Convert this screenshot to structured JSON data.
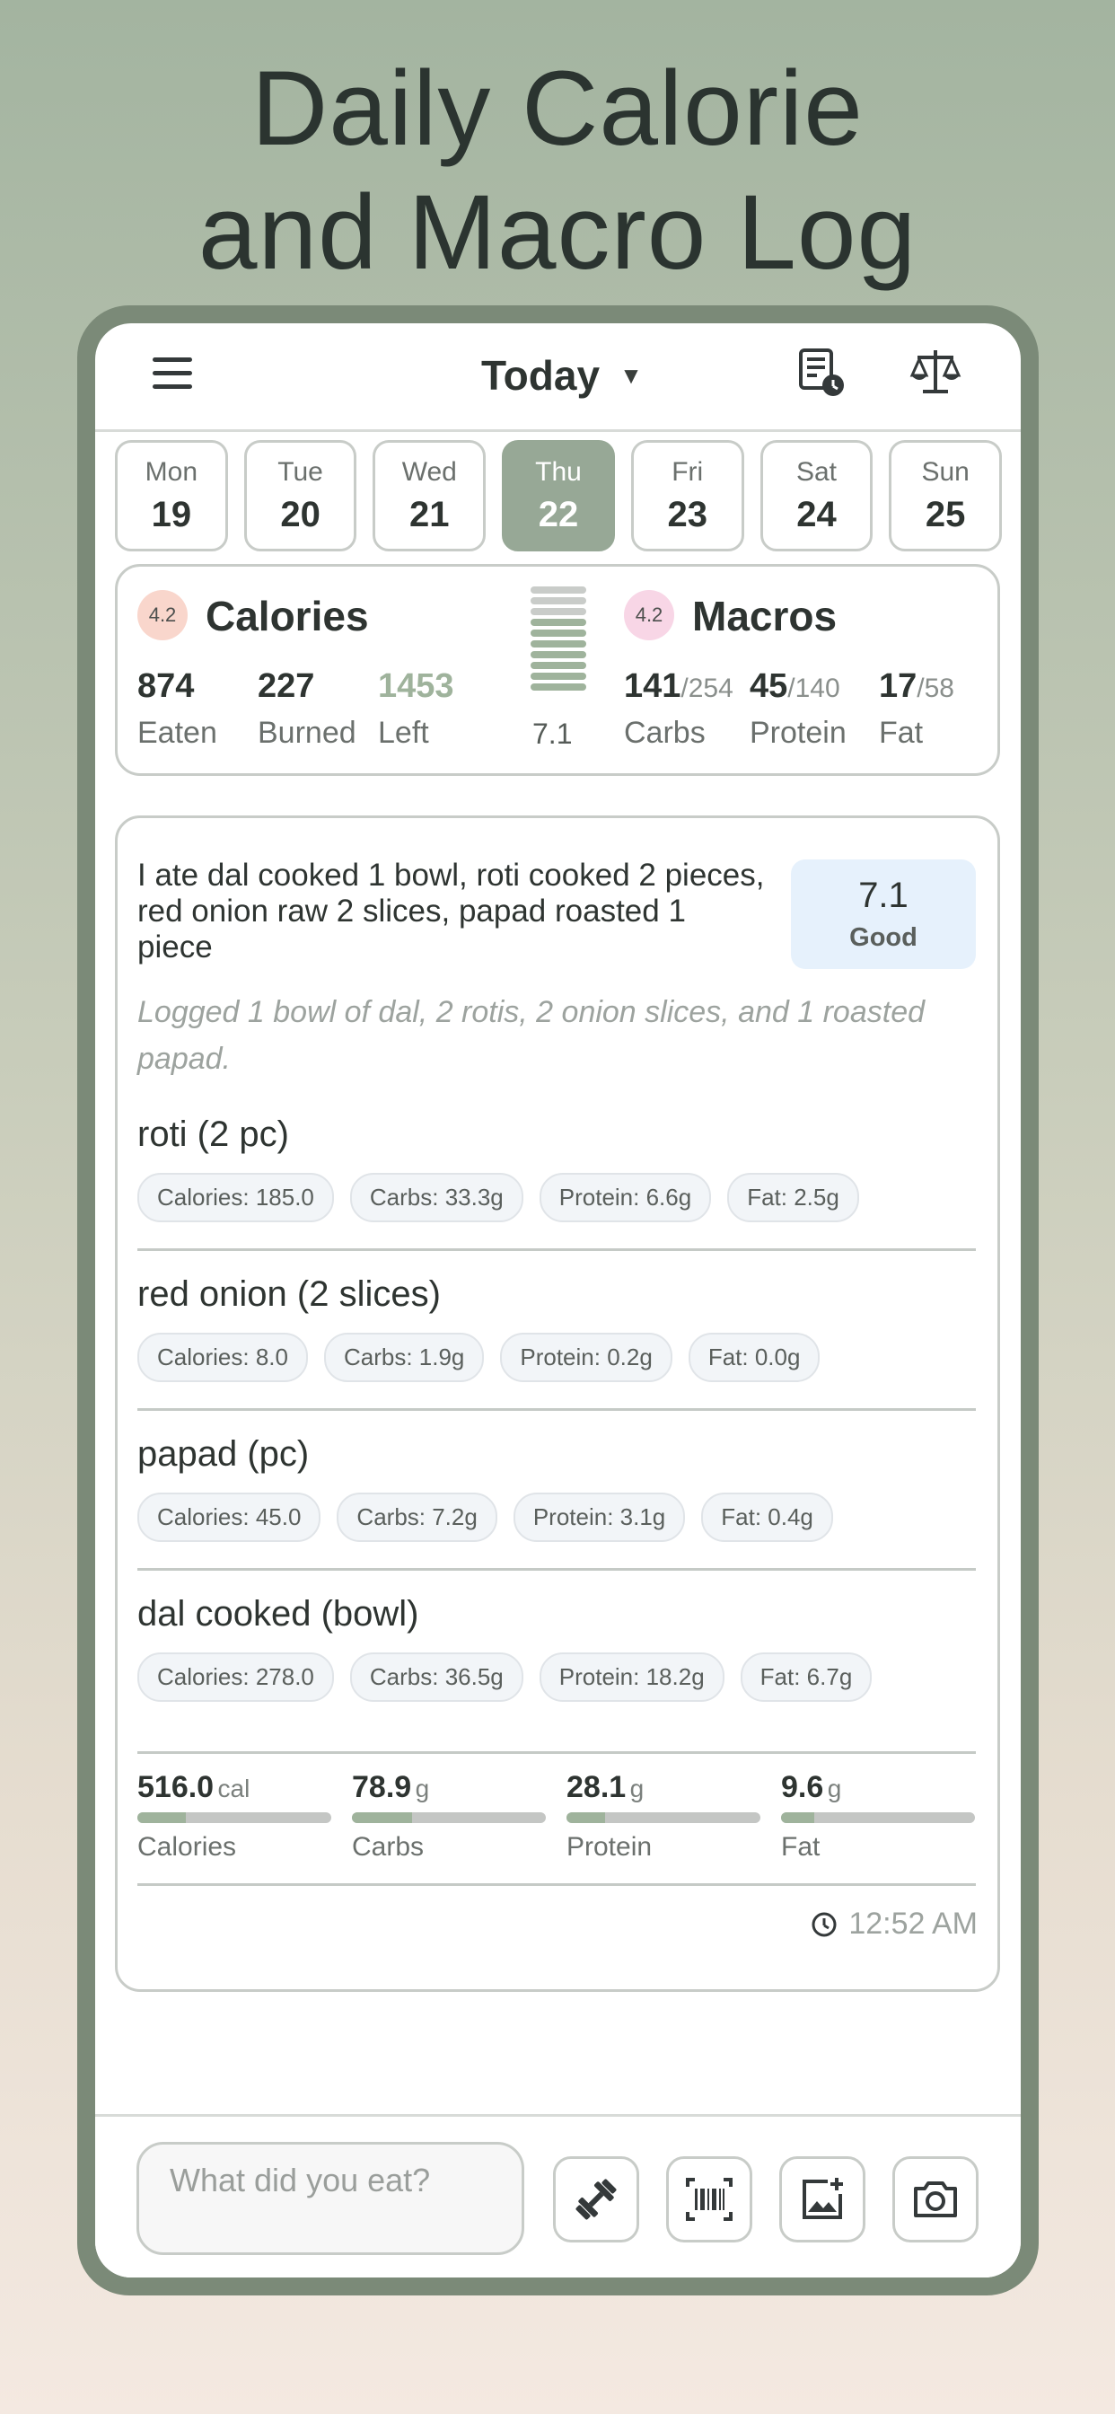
{
  "promo": {
    "title_line1": "Daily Calorie",
    "title_line2": "and Macro Log"
  },
  "header": {
    "title": "Today",
    "caret": "▼",
    "icons": [
      "menu-icon",
      "log-history-icon",
      "scale-icon"
    ]
  },
  "days": [
    {
      "name": "Mon",
      "date": "19",
      "active": false
    },
    {
      "name": "Tue",
      "date": "20",
      "active": false
    },
    {
      "name": "Wed",
      "date": "21",
      "active": false
    },
    {
      "name": "Thu",
      "date": "22",
      "active": true
    },
    {
      "name": "Fri",
      "date": "23",
      "active": false
    },
    {
      "name": "Sat",
      "date": "24",
      "active": false
    },
    {
      "name": "Sun",
      "date": "25",
      "active": false
    }
  ],
  "calories": {
    "badge": "4.2",
    "title": "Calories",
    "eaten": "874",
    "eaten_label": "Eaten",
    "burned": "227",
    "burned_label": "Burned",
    "left": "1453",
    "left_label": "Left"
  },
  "meter": {
    "score": "7.1",
    "levels": 10,
    "filled": 7
  },
  "macros": {
    "badge": "4.2",
    "title": "Macros",
    "carbs": "141",
    "carbs_goal": "/254",
    "carbs_label": "Carbs",
    "protein": "45",
    "protein_goal": "/140",
    "protein_label": "Protein",
    "fat": "17",
    "fat_goal": "/58",
    "fat_label": "Fat"
  },
  "entry": {
    "text": "I ate dal cooked 1 bowl, roti cooked 2 pieces, red onion raw 2 slices, papad roasted 1 piece",
    "score": "7.1",
    "score_label": "Good",
    "note": "Logged 1 bowl of dal, 2 rotis, 2 onion slices, and 1 roasted papad.",
    "foods": [
      {
        "name": "roti (2 pc)",
        "calories": "Calories: 185.0",
        "carbs": "Carbs: 33.3g",
        "protein": "Protein: 6.6g",
        "fat": "Fat: 2.5g"
      },
      {
        "name": "red onion (2 slices)",
        "calories": "Calories: 8.0",
        "carbs": "Carbs: 1.9g",
        "protein": "Protein: 0.2g",
        "fat": "Fat: 0.0g"
      },
      {
        "name": "papad (pc)",
        "calories": "Calories: 45.0",
        "carbs": "Carbs: 7.2g",
        "protein": "Protein: 3.1g",
        "fat": "Fat: 0.4g"
      },
      {
        "name": "dal cooked (bowl)",
        "calories": "Calories: 278.0",
        "carbs": "Carbs: 36.5g",
        "protein": "Protein: 18.2g",
        "fat": "Fat: 6.7g"
      }
    ],
    "totals": [
      {
        "value": "516.0",
        "unit": "cal",
        "label": "Calories",
        "progress": 0.25
      },
      {
        "value": "78.9",
        "unit": "g",
        "label": "Carbs",
        "progress": 0.31
      },
      {
        "value": "28.1",
        "unit": "g",
        "label": "Protein",
        "progress": 0.2
      },
      {
        "value": "9.6",
        "unit": "g",
        "label": "Fat",
        "progress": 0.17
      }
    ],
    "time": "12:52 AM"
  },
  "composer": {
    "placeholder": "What did you eat?",
    "actions": [
      "exercise-icon",
      "barcode-icon",
      "add-photo-icon",
      "camera-icon"
    ]
  },
  "colors": {
    "accent": "#97a896",
    "left_calories": "#9fb39c",
    "calorie_badge": "#f9d6cc",
    "macro_badge": "#f8d6e6",
    "score_box": "#e6f1fc"
  }
}
